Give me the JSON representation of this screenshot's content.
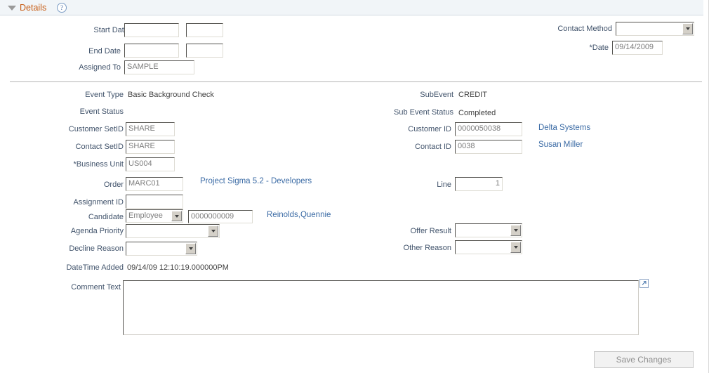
{
  "group": {
    "title": "Details",
    "help_icon": "help-question-icon",
    "collapse_icon": "collapse-triangle-icon"
  },
  "form": {
    "start_date": {
      "label": "Start Date:",
      "value": "",
      "value2": ""
    },
    "end_date": {
      "label": "End Date",
      "value": "",
      "value2": ""
    },
    "assigned_to": {
      "label": "Assigned To",
      "value": "SAMPLE"
    },
    "contact_method": {
      "label": "Contact Method",
      "value": ""
    },
    "date": {
      "label": "*Date",
      "value": "09/14/2009"
    },
    "event_type": {
      "label": "Event Type",
      "value": "Basic Background Check"
    },
    "event_status": {
      "label": "Event Status",
      "value": ""
    },
    "sub_event": {
      "label": "SubEvent",
      "value": "CREDIT"
    },
    "sub_event_status": {
      "label": "Sub Event Status",
      "value": "Completed"
    },
    "customer_setid": {
      "label": "Customer SetID",
      "value": "SHARE"
    },
    "contact_setid": {
      "label": "Contact SetID",
      "value": "SHARE"
    },
    "business_unit": {
      "label": "*Business Unit",
      "value": "US004"
    },
    "customer_id": {
      "label": "Customer ID",
      "value": "0000050038",
      "link": "Delta Systems"
    },
    "contact_id": {
      "label": "Contact ID",
      "value": "0038",
      "link": "Susan Miller"
    },
    "order": {
      "label": "Order",
      "value": "MARC01",
      "link": "Project Sigma 5.2 - Developers"
    },
    "line": {
      "label": "Line",
      "value": "1"
    },
    "assignment_id": {
      "label": "Assignment ID",
      "value": ""
    },
    "candidate": {
      "label": "Candidate",
      "type_value": "Employee",
      "id_value": "0000000009",
      "link": "Reinolds,Quennie"
    },
    "agenda_priority": {
      "label": "Agenda Priority",
      "value": ""
    },
    "decline_reason": {
      "label": "Decline Reason",
      "value": ""
    },
    "offer_result": {
      "label": "Offer Result",
      "value": ""
    },
    "other_reason": {
      "label": "Other Reason",
      "value": ""
    },
    "datetime_added": {
      "label": "DateTime Added",
      "value": "09/14/09 12:10:19.000000PM"
    },
    "comment_text": {
      "label": "Comment Text",
      "value": "",
      "expand_icon": "expand-popout-icon"
    }
  },
  "actions": {
    "save_label": "Save Changes"
  },
  "colors": {
    "header_bg": "#f1f5f8",
    "title": "#c75b12",
    "label": "#41536b",
    "link": "#3b6ba5",
    "field_text": "#7d7d7d"
  }
}
